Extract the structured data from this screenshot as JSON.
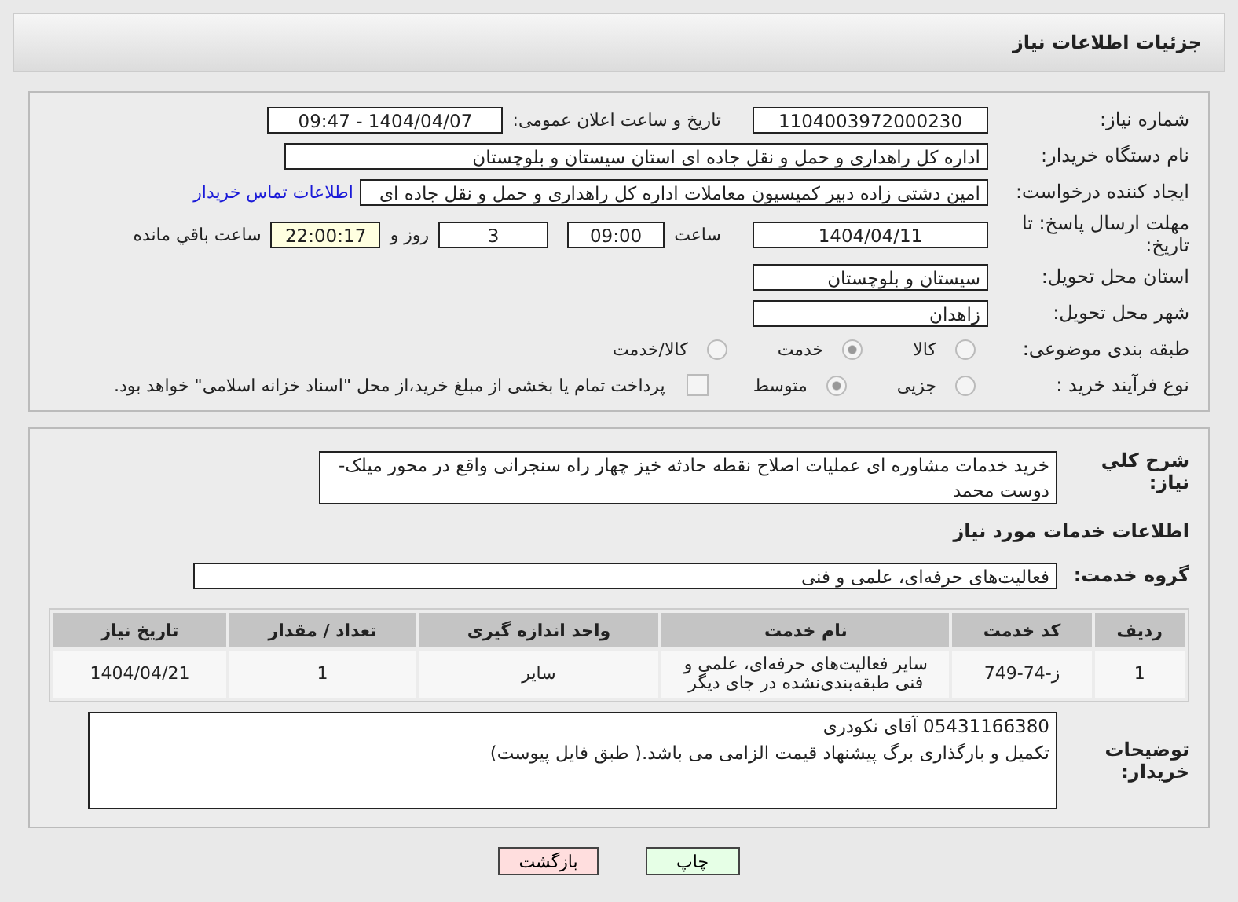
{
  "header": {
    "title": "جزئیات اطلاعات نیاز"
  },
  "details": {
    "need_number": {
      "label": "شماره نیاز:",
      "value": "1104003972000230"
    },
    "announce": {
      "label": "تاریخ و ساعت اعلان عمومی:",
      "value": "1404/04/07 - 09:47"
    },
    "buyer": {
      "label": "نام دستگاه خریدار:",
      "value": "اداره کل راهداری و حمل و نقل جاده ای استان سیستان و بلوچستان"
    },
    "creator": {
      "label": "ایجاد کننده درخواست:",
      "value": "امین دشتی زاده دبیر کمیسیون معاملات اداره کل راهداری و حمل و نقل جاده ای",
      "link": "اطلاعات تماس خریدار"
    },
    "deadline": {
      "label": "مهلت ارسال پاسخ: تا تاریخ:",
      "date": "1404/04/11",
      "time_label": "ساعت",
      "time": "09:00",
      "days": "3",
      "days_label": "روز و",
      "remaining": "22:00:17",
      "remaining_label": "ساعت باقي مانده"
    },
    "province": {
      "label": "استان محل تحویل:",
      "value": "سیستان و بلوچستان"
    },
    "city": {
      "label": "شهر محل تحویل:",
      "value": "زاهدان"
    },
    "category": {
      "label": "طبقه بندی موضوعی:",
      "options": [
        {
          "label": "کالا",
          "selected": false
        },
        {
          "label": "خدمت",
          "selected": true
        },
        {
          "label": "کالا/خدمت",
          "selected": false
        }
      ]
    },
    "process": {
      "label": "نوع فرآیند خرید :",
      "options": [
        {
          "label": "جزیی",
          "selected": false
        },
        {
          "label": "متوسط",
          "selected": true
        }
      ],
      "treasury": {
        "label": "پرداخت تمام یا بخشی از مبلغ خرید،از محل \"اسناد خزانه اسلامی\" خواهد بود.",
        "checked": false
      }
    }
  },
  "needs": {
    "description": {
      "label": "شرح کلي نیاز:",
      "value": "خرید خدمات مشاوره ای عملیات اصلاح نقطه حادثه خیز چهار راه سنجرانی واقع در محور میلک-دوست محمد"
    },
    "section_title": "اطلاعات خدمات مورد نیاز",
    "service_group": {
      "label": "گروه خدمت:",
      "value": "فعالیت‌های حرفه‌ای، علمی و فنی"
    },
    "table": {
      "columns": [
        "ردیف",
        "کد خدمت",
        "نام خدمت",
        "واحد اندازه گیری",
        "تعداد / مقدار",
        "تاریخ نیاز"
      ],
      "rows": [
        [
          "1",
          "ز-74-749",
          "سایر فعالیت‌های حرفه‌ای، علمی و فنی طبقه‌بندی‌نشده در جای دیگر",
          "سایر",
          "1",
          "1404/04/21"
        ]
      ]
    },
    "buyer_notes": {
      "label": "توضیحات خریدار:",
      "lines": [
        "05431166380 آقای نکودری",
        "تکمیل و بارگذاری برگ پیشنهاد قیمت الزامی می باشد.( طبق فایل پیوست)"
      ]
    }
  },
  "buttons": [
    {
      "label": "چاپ",
      "kind": "print"
    },
    {
      "label": "بازگشت",
      "kind": "back"
    }
  ]
}
